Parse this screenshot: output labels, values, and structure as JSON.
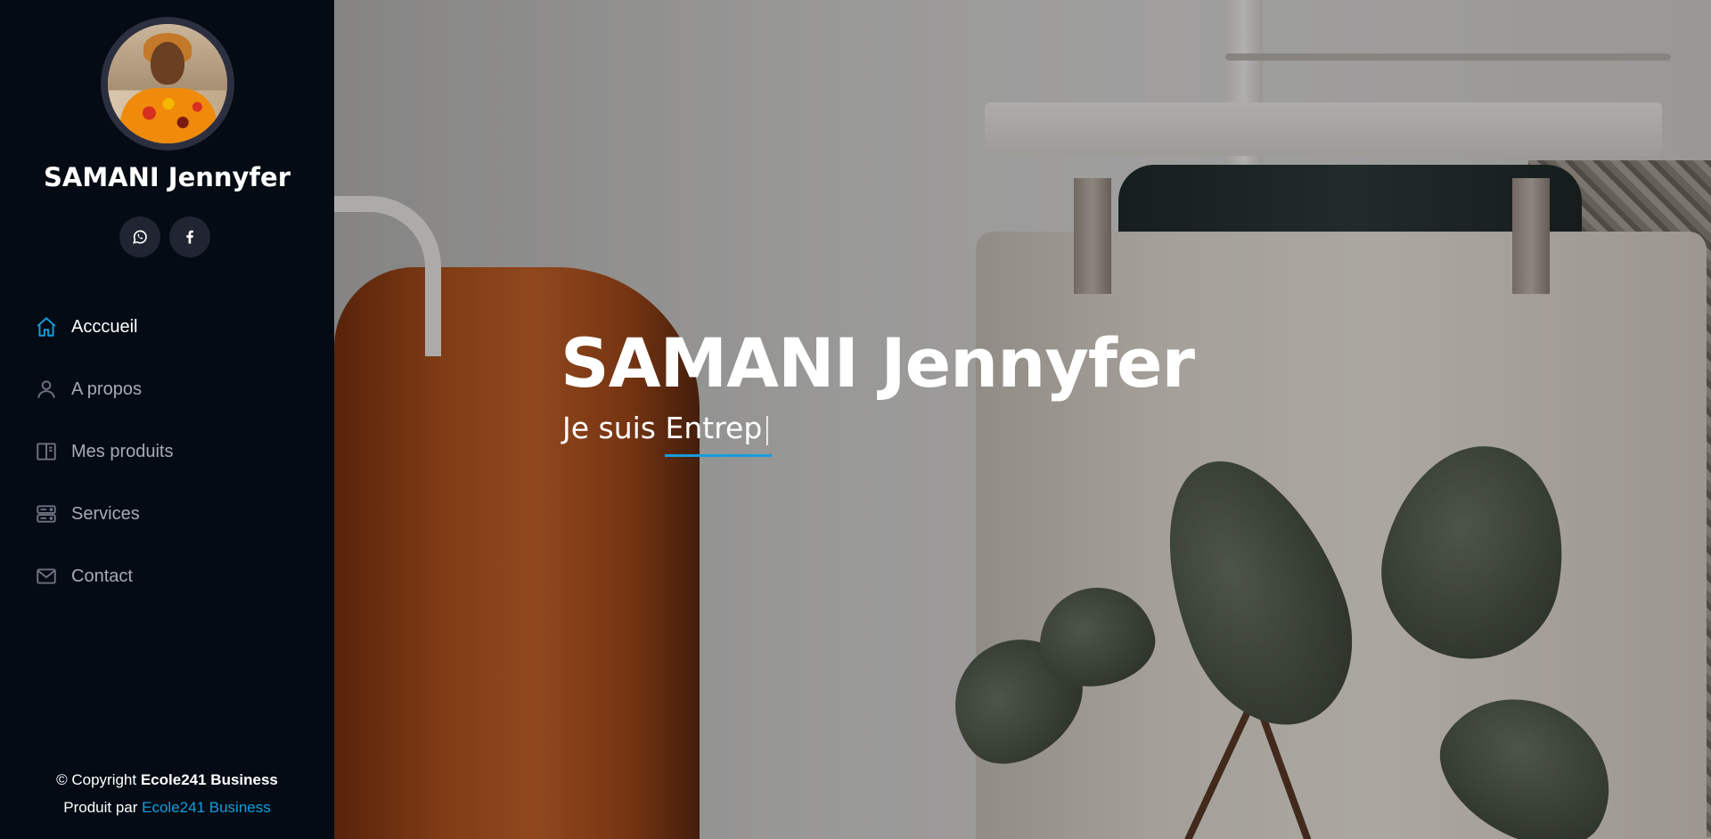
{
  "profile": {
    "name": "SAMANI Jennyfer",
    "avatar_icon": "profile-photo"
  },
  "social": [
    {
      "name": "whatsapp",
      "icon": "whatsapp-icon"
    },
    {
      "name": "facebook",
      "icon": "facebook-icon"
    }
  ],
  "nav": {
    "items": [
      {
        "label": "Acccueil",
        "icon": "home-icon",
        "active": true
      },
      {
        "label": "A propos",
        "icon": "user-icon",
        "active": false
      },
      {
        "label": "Mes produits",
        "icon": "book-half-icon",
        "active": false
      },
      {
        "label": "Services",
        "icon": "server-icon",
        "active": false
      },
      {
        "label": "Contact",
        "icon": "envelope-icon",
        "active": false
      }
    ]
  },
  "footer": {
    "copyright_prefix": "© Copyright ",
    "copyright_brand": "Ecole241 Business",
    "produced_prefix": "Produit par ",
    "produced_link": "Ecole241 Business"
  },
  "hero": {
    "title": "SAMANI Jennyfer",
    "subtitle_prefix": "Je suis ",
    "typed_text": "Entrep",
    "cursor": "|"
  },
  "colors": {
    "accent": "#149ddd",
    "sidebar_bg": "#040b14",
    "nav_text": "#a8a9b4",
    "social_bg": "#212431"
  }
}
